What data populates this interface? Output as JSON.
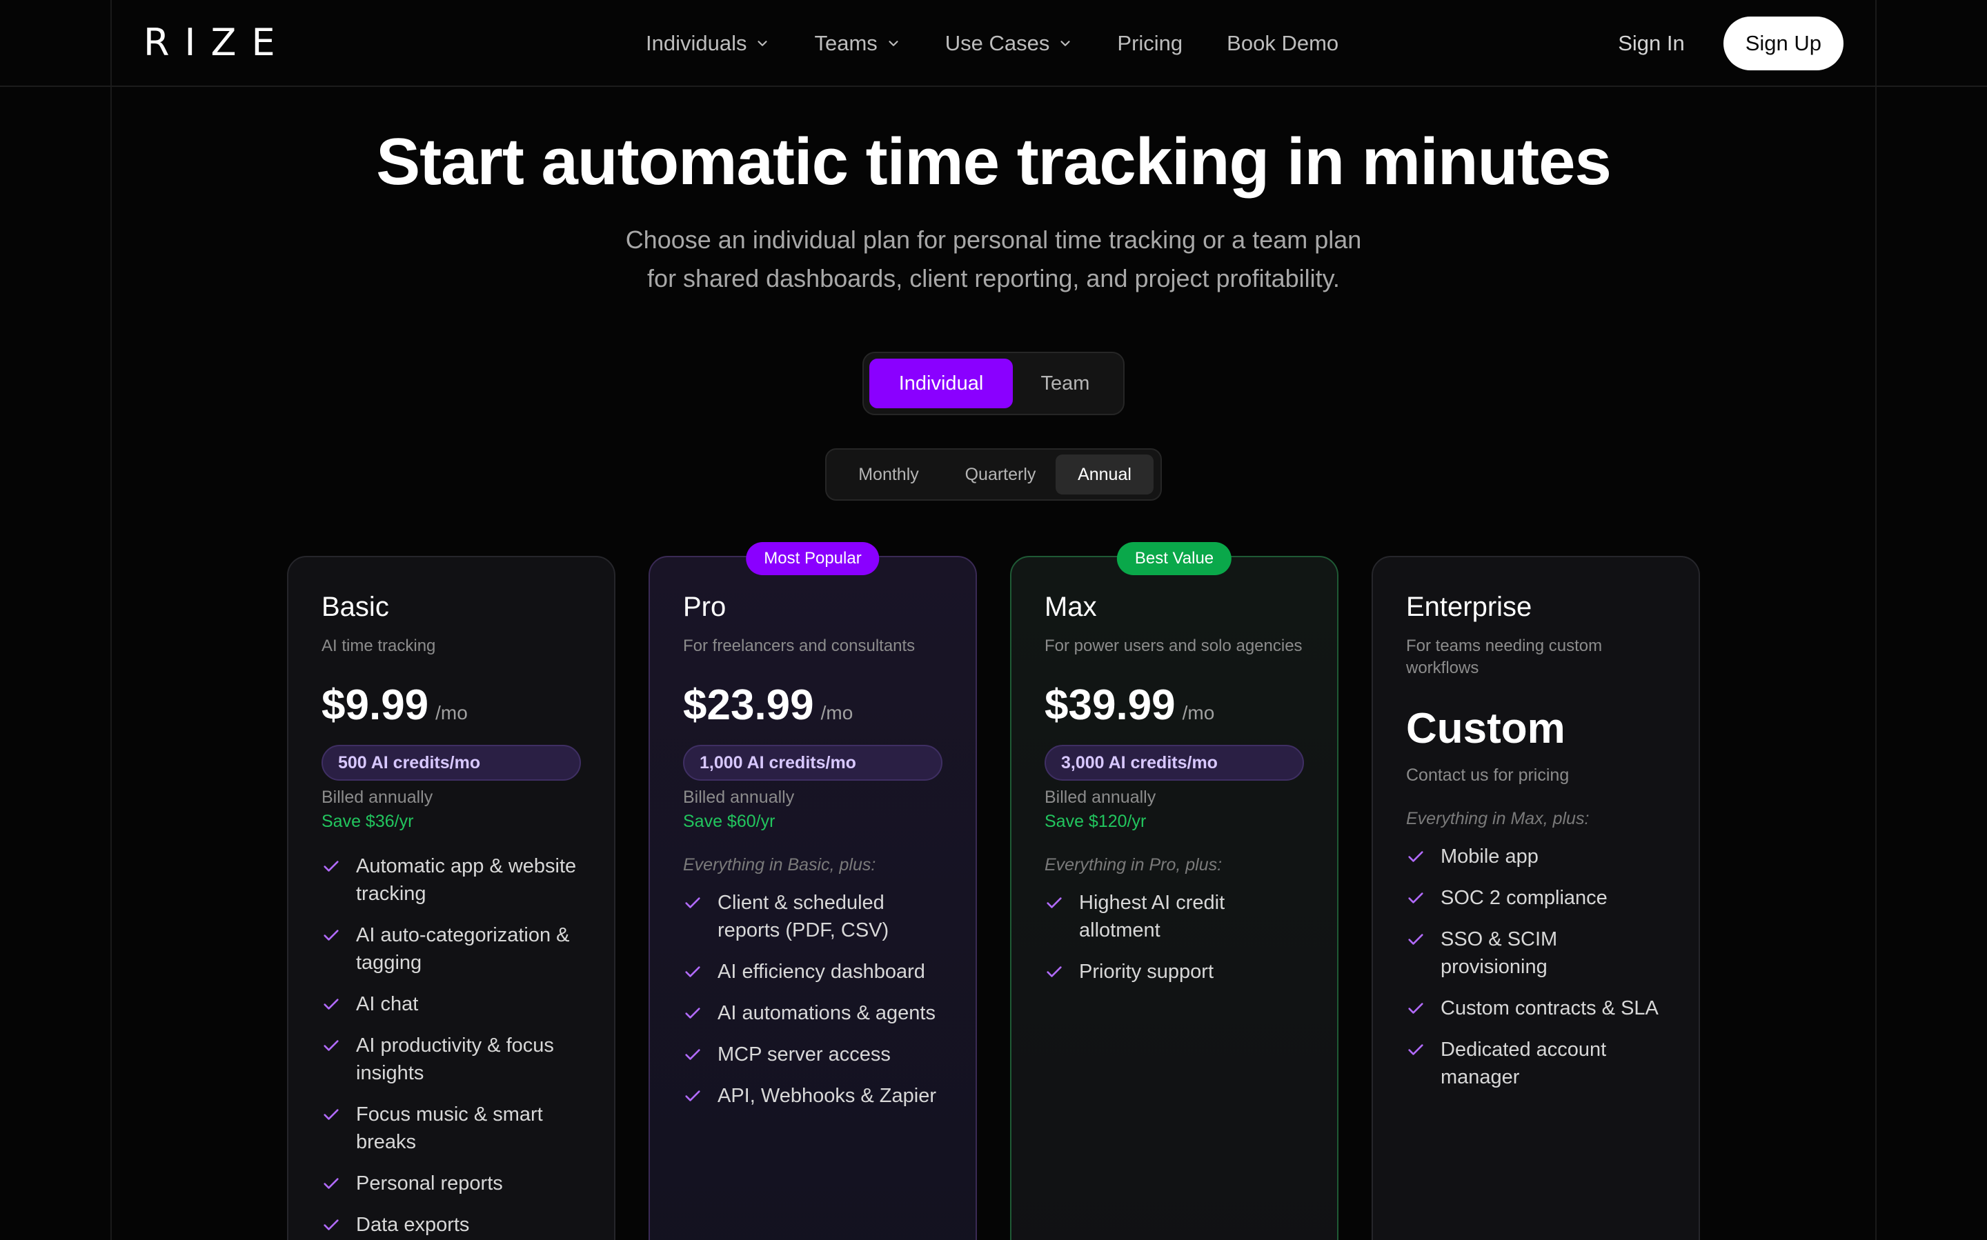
{
  "brand": {
    "logo": "RIZE"
  },
  "nav": {
    "links": [
      {
        "label": "Individuals",
        "has_dropdown": true
      },
      {
        "label": "Teams",
        "has_dropdown": true
      },
      {
        "label": "Use Cases",
        "has_dropdown": true
      },
      {
        "label": "Pricing",
        "has_dropdown": false
      },
      {
        "label": "Book Demo",
        "has_dropdown": false
      }
    ],
    "sign_in": "Sign In",
    "sign_up": "Sign Up"
  },
  "hero": {
    "title": "Start automatic time tracking in minutes",
    "subtitle_line1": "Choose an individual plan for personal time tracking or a team plan",
    "subtitle_line2": "for shared dashboards, client reporting, and project profitability."
  },
  "plan_type_toggle": {
    "options": [
      "Individual",
      "Team"
    ],
    "selected": "Individual"
  },
  "billing_toggle": {
    "options": [
      "Monthly",
      "Quarterly",
      "Annual"
    ],
    "selected": "Annual"
  },
  "colors": {
    "accent_purple": "#8a00ff",
    "accent_green": "#0aa84a",
    "save_green": "#22c55e",
    "check_purple": "#b26bff"
  },
  "cards": {
    "basic": {
      "name": "Basic",
      "desc": "AI time tracking",
      "price": "$9.99",
      "per": "/mo",
      "credits": "500 AI credits/mo",
      "billed": "Billed annually",
      "save": "Save $36/yr",
      "features": [
        "Automatic app & website tracking",
        "AI auto-categorization & tagging",
        "AI chat",
        "AI productivity & focus insights",
        "Focus music & smart breaks",
        "Personal reports",
        "Data exports"
      ]
    },
    "pro": {
      "badge": "Most Popular",
      "name": "Pro",
      "desc": "For freelancers and consultants",
      "price": "$23.99",
      "per": "/mo",
      "credits": "1,000 AI credits/mo",
      "billed": "Billed annually",
      "save": "Save $60/yr",
      "everything": "Everything in Basic, plus:",
      "features": [
        "Client & scheduled reports (PDF, CSV)",
        "AI efficiency dashboard",
        "AI automations & agents",
        "MCP server access",
        "API, Webhooks & Zapier"
      ]
    },
    "max": {
      "badge": "Best Value",
      "name": "Max",
      "desc": "For power users and solo agencies",
      "price": "$39.99",
      "per": "/mo",
      "credits": "3,000 AI credits/mo",
      "billed": "Billed annually",
      "save": "Save $120/yr",
      "everything": "Everything in Pro, plus:",
      "features": [
        "Highest AI credit allotment",
        "Priority support"
      ]
    },
    "enterprise": {
      "name": "Enterprise",
      "desc": "For teams needing custom workflows",
      "price": "Custom",
      "contact": "Contact us for pricing",
      "everything": "Everything in Max, plus:",
      "features": [
        "Mobile app",
        "SOC 2 compliance",
        "SSO & SCIM provisioning",
        "Custom contracts & SLA",
        "Dedicated account manager"
      ]
    }
  }
}
